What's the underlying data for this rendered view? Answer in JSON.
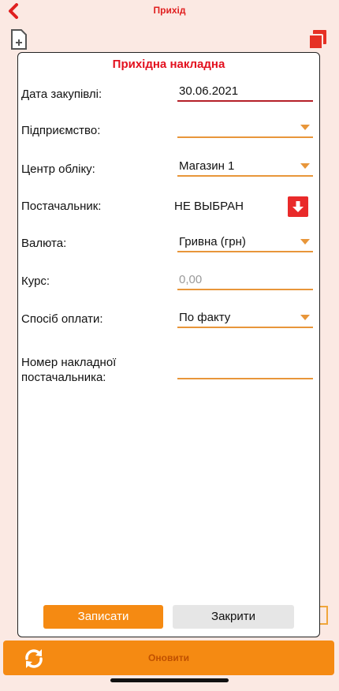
{
  "app": {
    "title": "Прихід"
  },
  "icons": {
    "back": "chevron-left-icon",
    "document": "document-icon",
    "copy": "copy-icon",
    "refresh": "refresh-icon",
    "download": "arrow-down-icon"
  },
  "bottom_bar": {
    "refresh_label": "Оновити"
  },
  "modal": {
    "title": "Прихідна накладна",
    "fields": {
      "purchase_date": {
        "label": "Дата закупівлі:",
        "value": "30.06.2021"
      },
      "enterprise": {
        "label": "Підприємство:",
        "value": ""
      },
      "accounting_center": {
        "label": "Центр обліку:",
        "value": "Магазин 1"
      },
      "supplier": {
        "label": "Постачальник:",
        "value": "НЕ ВЫБРАН"
      },
      "currency": {
        "label": "Валюта:",
        "value": "Гривна (грн)"
      },
      "rate": {
        "label": "Курс:",
        "placeholder": "0,00"
      },
      "payment_method": {
        "label": "Спосіб оплати:",
        "value": "По факту"
      },
      "supplier_invoice_number": {
        "label_line1": "Номер накладної",
        "label_line2": "постачальника:",
        "value": ""
      }
    },
    "buttons": {
      "save": "Записати",
      "close": "Закрити"
    }
  },
  "colors": {
    "accent_orange": "#f58a12",
    "title_red": "#e3101e",
    "underline_orange": "#e8963a",
    "underline_active": "#b52028"
  }
}
